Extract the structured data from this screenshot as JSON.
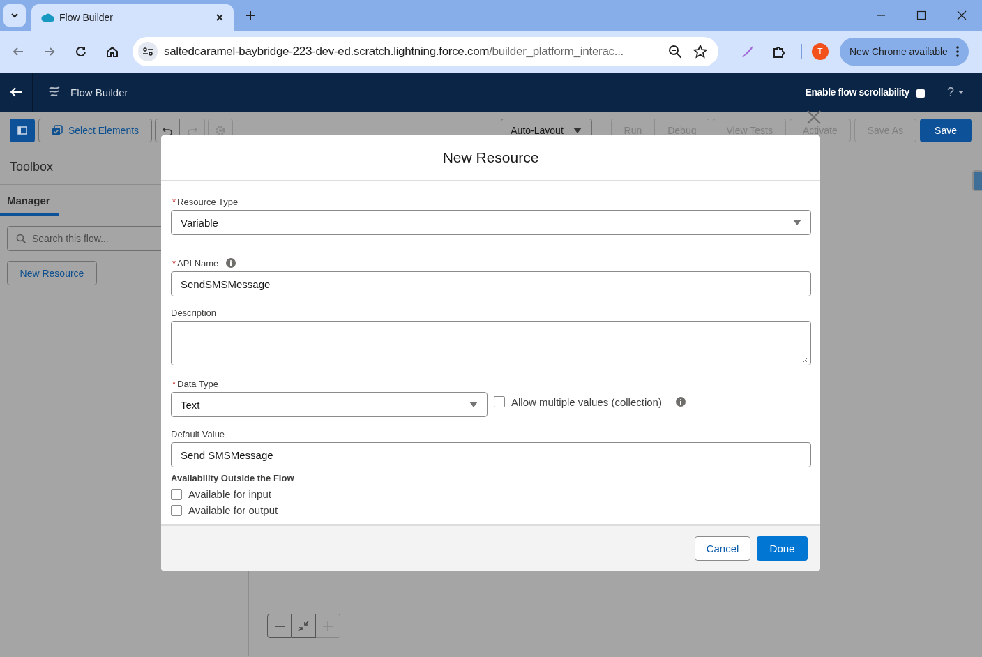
{
  "browser": {
    "tab_title": "Flow Builder",
    "url_host": "saltedcaramel-baybridge-223-dev-ed.scratch.lightning.force.com",
    "url_path": "/builder_platform_interac...",
    "update_button": "New Chrome available",
    "profile_initial": "T"
  },
  "app_header": {
    "title": "Flow Builder",
    "scroll_toggle": {
      "label": "Enable flow scrollability",
      "checked": false
    },
    "help": "?"
  },
  "toolbar": {
    "select_elements": "Select Elements",
    "layout": "Auto-Layout",
    "buttons": [
      {
        "label": "Run",
        "disabled": true,
        "kind": "grouped"
      },
      {
        "label": "Debug",
        "disabled": true,
        "kind": "grouped"
      },
      {
        "label": "View Tests",
        "disabled": true,
        "kind": "plain"
      },
      {
        "label": "Activate",
        "disabled": true,
        "kind": "plain"
      },
      {
        "label": "Save As",
        "disabled": true,
        "kind": "plain"
      },
      {
        "label": "Save",
        "disabled": false,
        "kind": "brand"
      }
    ]
  },
  "sidebar": {
    "title": "Toolbox",
    "tabs": [
      {
        "label": "Manager",
        "selected": true
      }
    ],
    "search": {
      "placeholder": "Search this flow..."
    },
    "new_resource": "New Resource"
  },
  "modal": {
    "title": "New Resource",
    "resource_type": {
      "required_mark": "*",
      "label": "Resource Type",
      "value": "Variable"
    },
    "api_name": {
      "required_mark": "*",
      "label": "API Name",
      "value": "SendSMSMessage",
      "info": true
    },
    "description": {
      "label": "Description"
    },
    "data_type": {
      "required_mark": "*",
      "label": "Data Type",
      "value": "Text"
    },
    "collection": {
      "label": "Allow multiple values (collection)",
      "checked": false,
      "info": true
    },
    "default_value": {
      "label": "Default Value",
      "value": "Send SMSMessage"
    },
    "availability": {
      "heading": "Availability Outside the Flow",
      "options": [
        {
          "label": "Available for input",
          "checked": false
        },
        {
          "label": "Available for output",
          "checked": false
        }
      ]
    },
    "cancel": "Cancel",
    "done": "Done"
  }
}
